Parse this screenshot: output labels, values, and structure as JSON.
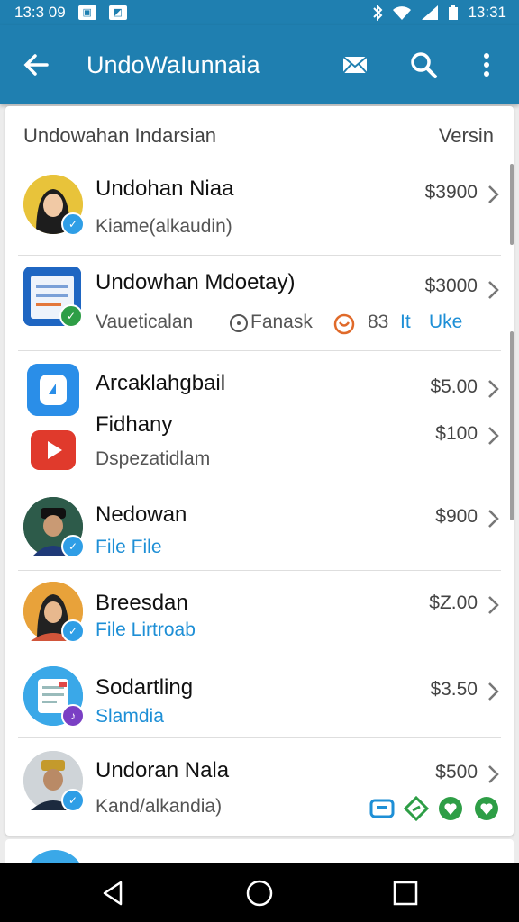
{
  "status": {
    "time_left": "13:3 09",
    "time_right": "13:31"
  },
  "appbar": {
    "title": "UndoWaIunnaia"
  },
  "list_header": {
    "left": "Undowahan Indarsian",
    "right": "Versin"
  },
  "rows": [
    {
      "name": "Undohan Niaa",
      "sub": "Kiame(alkaudin)",
      "price": "$3900"
    },
    {
      "name": "Undowhan Mdoetay)",
      "sub": "Vaueticalan",
      "price": "$3000",
      "extra1": "Fanask",
      "extra2": "83",
      "extra3": "It",
      "extra4": "Uke"
    },
    {
      "name": "Arcaklahgbail",
      "price": "$5.00"
    },
    {
      "name": "Fidhany",
      "sub": "Dspezatidlam",
      "price": "$100"
    },
    {
      "name": "Nedowan",
      "sub": "File File",
      "price": "$900"
    },
    {
      "name": "Breesdan",
      "sub": "File Lirtroab",
      "price": "$Z.00"
    },
    {
      "name": "Sodartling",
      "sub": "Slamdia",
      "price": "$3.50"
    },
    {
      "name": "Undoran Nala",
      "sub": "Kand/alkandia)",
      "price": "$500"
    }
  ],
  "colors": {
    "appbar": "#1f7fb0",
    "accent_blue": "#1e8fd6",
    "verified": "#2f9ee6",
    "green": "#2e9e46"
  }
}
